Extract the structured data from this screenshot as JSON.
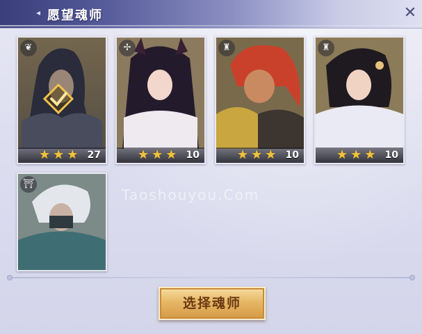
{
  "window": {
    "title": "愿望魂师"
  },
  "cards": [
    {
      "stars": 3,
      "level": "27",
      "class_icon": "wing-icon",
      "selected": true
    },
    {
      "stars": 3,
      "level": "10",
      "class_icon": "bird-icon",
      "selected": false
    },
    {
      "stars": 3,
      "level": "10",
      "class_icon": "tower-icon",
      "selected": false
    },
    {
      "stars": 3,
      "level": "10",
      "class_icon": "tower-icon",
      "selected": false
    },
    {
      "stars": 0,
      "level": "",
      "class_icon": "gate-icon",
      "selected": false
    }
  ],
  "watermark": "Taoshouyou.Com",
  "actions": {
    "select_label": "选择魂师"
  },
  "colors": {
    "star": "#f1c23a",
    "button": "#e6b766",
    "title_bar": "#4f5493"
  }
}
